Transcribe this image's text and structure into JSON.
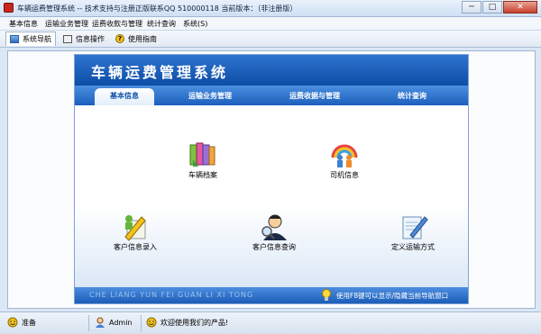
{
  "window": {
    "title": "车辆运费管理系统 -- 技术支持与注册正版联系QQ 510000118   当前版本：（非注册版）",
    "min": "─",
    "max": "□",
    "close": "✕"
  },
  "menu": [
    "基本信息",
    "运输业务管理",
    "运费收款与管理",
    "统计查询",
    "系统(S)"
  ],
  "tabs": [
    {
      "label": "系统导航",
      "icon": "monitor-icon",
      "active": true
    },
    {
      "label": "信息操作",
      "icon": "window-icon",
      "active": false
    },
    {
      "label": "使用指南",
      "icon": "help-icon",
      "active": false
    }
  ],
  "panel": {
    "title": "车辆运费管理系统",
    "nav": [
      "基本信息",
      "运输业务管理",
      "运费收据与管理",
      "统计查询"
    ],
    "active_nav": "基本信息",
    "modules": [
      {
        "label": "车辆档案",
        "icon": "books-icon"
      },
      {
        "label": "司机信息",
        "icon": "rainbow-people-icon"
      },
      {
        "label": "客户信息录入",
        "icon": "pencil-person-icon"
      },
      {
        "label": "客户信息查询",
        "icon": "search-person-icon"
      },
      {
        "label": "定义运输方式",
        "icon": "document-pen-icon"
      }
    ],
    "footer_pinyin": "CHE LIANG YUN FEI GUAN LI XI TONG",
    "footer_hint": "使用F8键可以显示/隐藏当前导航窗口"
  },
  "status": {
    "state": "准备",
    "user": "Admin",
    "welcome": "欢迎使用我们的产品!"
  }
}
